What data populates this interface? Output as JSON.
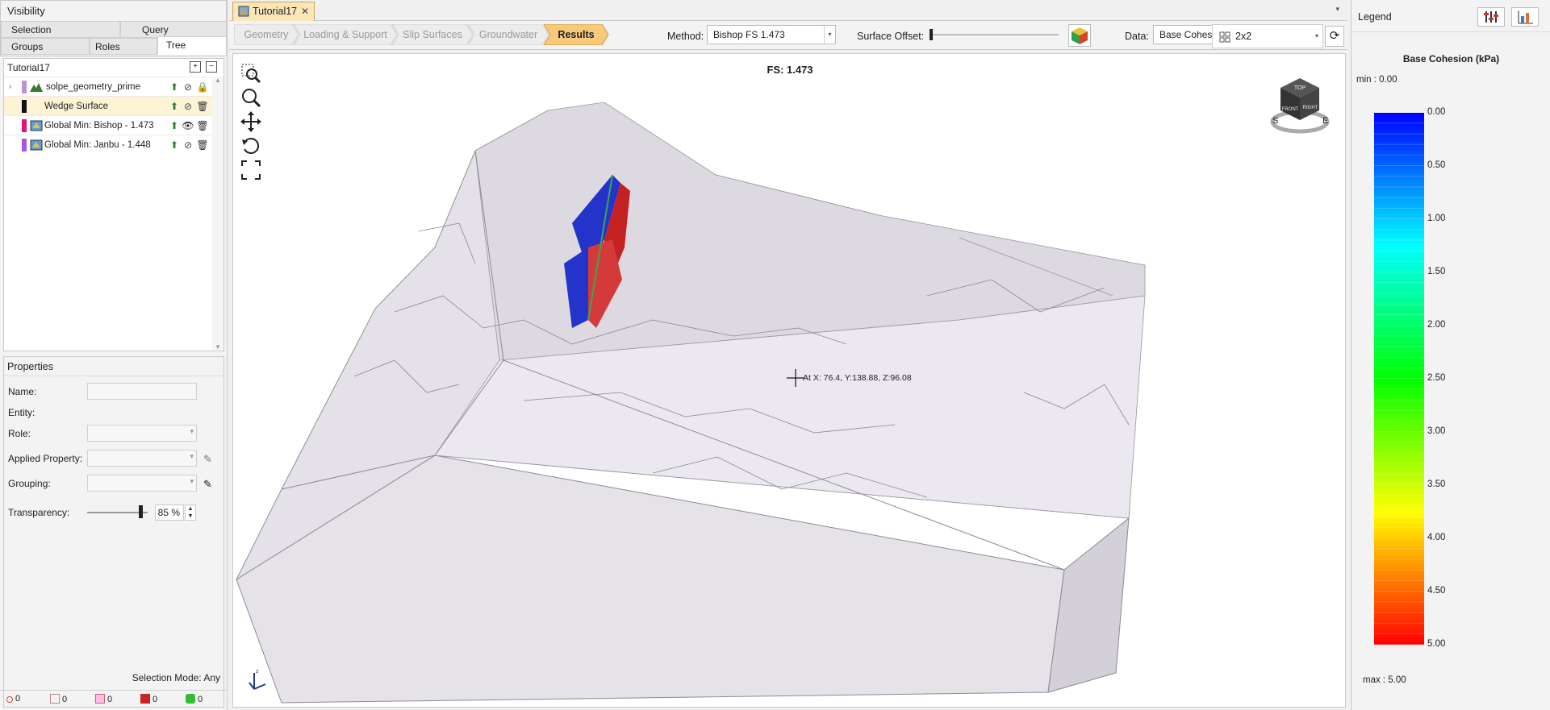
{
  "visibility": {
    "title": "Visibility",
    "tabs": [
      "Selection",
      "Query",
      "Groups",
      "Roles",
      "Tree"
    ],
    "active_tab": "Tree"
  },
  "tree": {
    "root": "Tutorial17",
    "items": [
      {
        "label": "solpe_geometry_prime",
        "color": "#b995d6",
        "expandable": true,
        "visible_icon": "hidden",
        "locked": true
      },
      {
        "label": "Wedge Surface",
        "color": "#111111",
        "selected": true,
        "visible_icon": "hidden",
        "locked": false
      },
      {
        "label": "Global Min: Bishop  -  1.473",
        "color": "#e2147a",
        "visible_icon": "visible",
        "locked": false
      },
      {
        "label": "Global Min: Janbu  -  1.448",
        "color": "#a855e8",
        "visible_icon": "hidden",
        "locked": false
      }
    ]
  },
  "properties": {
    "title": "Properties",
    "fields": [
      "Name:",
      "Entity:",
      "Role:",
      "Applied Property:",
      "Grouping:"
    ],
    "transparency_label": "Transparency:",
    "transparency_value": "85 %",
    "transparency": 0.85,
    "selection_mode": "Selection Mode: Any"
  },
  "status_counts": [
    "0",
    "0",
    "0",
    "0",
    "0"
  ],
  "document_tab": "Tutorial17",
  "workflow": {
    "steps": [
      "Geometry",
      "Loading & Support",
      "Slip Surfaces",
      "Groundwater",
      "Results"
    ],
    "active": "Results"
  },
  "toolbar": {
    "method_label": "Method:",
    "method_value": "Bishop FS    1.473",
    "surface_offset_label": "Surface Offset:",
    "data_label": "Data:",
    "data_value": "Base Cohesion",
    "layout_value": "2x2"
  },
  "viewport": {
    "fs_label": "FS: 1.473",
    "cursor_readout": "At X: 76.4, Y:138.88, Z:96.08",
    "compass": [
      "S",
      "E"
    ],
    "cube_faces": [
      "TOP",
      "FRONT",
      "RIGHT"
    ]
  },
  "legend": {
    "panel_title": "Legend",
    "title": "Base Cohesion (kPa)",
    "min_label": "min :  0.00",
    "max_label": "max :  5.00",
    "ticks": [
      "0.00",
      "0.50",
      "1.00",
      "1.50",
      "2.00",
      "2.50",
      "3.00",
      "3.50",
      "4.00",
      "4.50",
      "5.00"
    ],
    "colors": [
      "#0000ff",
      "#00ffff",
      "#00ff00",
      "#ffff00",
      "#ff0000"
    ]
  }
}
